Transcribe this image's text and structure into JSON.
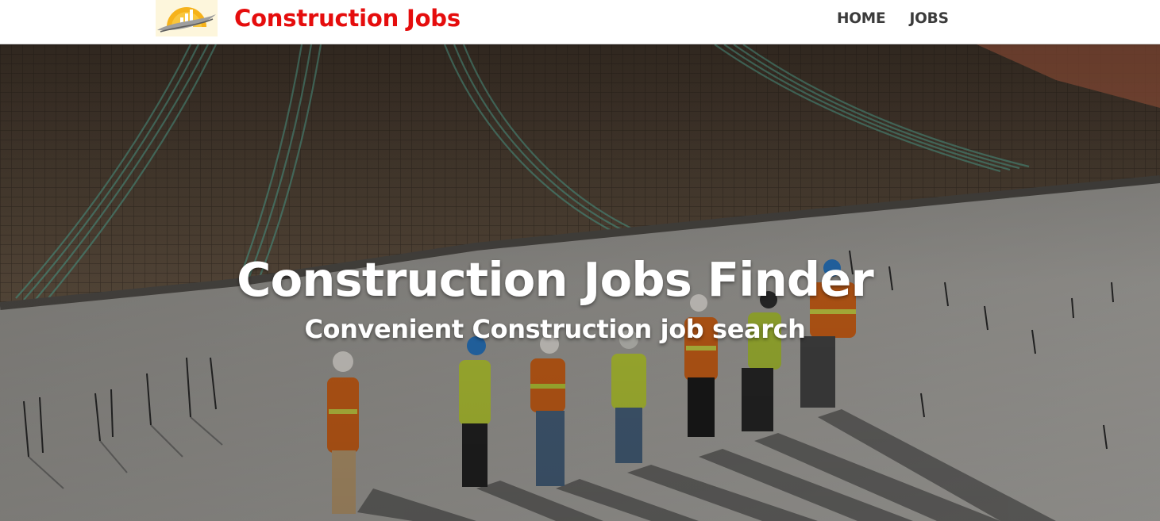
{
  "header": {
    "brand_title": "Construction Jobs",
    "brand_color": "#e50d0d",
    "logo_icon": "sunrise-chart-logo",
    "nav": [
      {
        "label": "HOME"
      },
      {
        "label": "JOBS"
      }
    ]
  },
  "hero": {
    "title": "Construction Jobs Finder",
    "subtitle": "Convenient Construction job search",
    "background_image": "construction-workers-on-rooftop-site"
  }
}
